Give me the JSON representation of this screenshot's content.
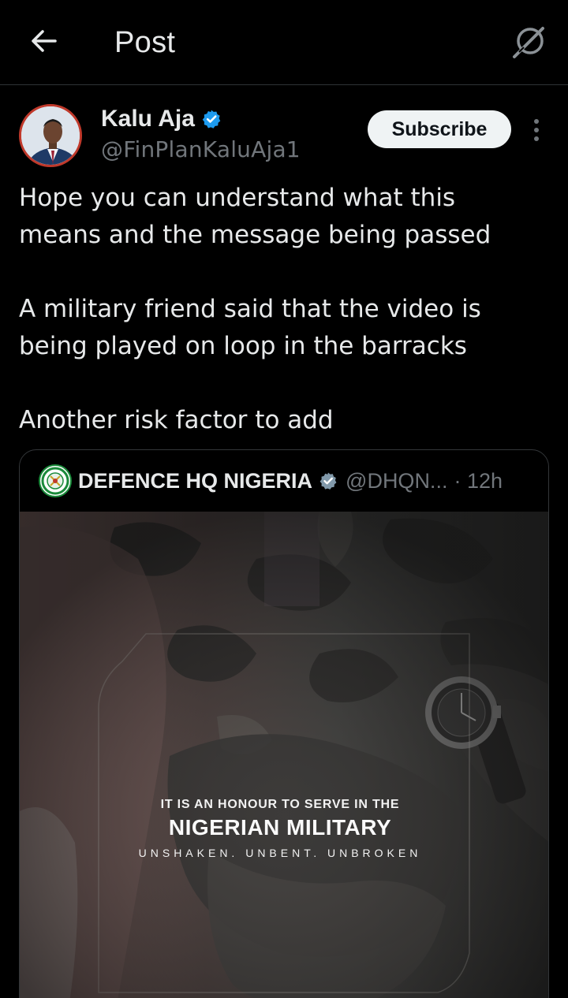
{
  "header": {
    "title": "Post",
    "back_icon": "arrow-left-icon",
    "grok_icon": "grok-icon"
  },
  "author": {
    "name": "Kalu Aja",
    "handle": "@FinPlanKaluAja1",
    "verified_color": "#1d9bf0",
    "subscribe_label": "Subscribe"
  },
  "tweet": {
    "text": "Hope you can understand what this\nmeans and the message being passed\n\nA military friend said that the video is\nbeing played on loop in the barracks\n\nAnother risk factor to add"
  },
  "quote": {
    "name": "DEFENCE HQ NIGERIA",
    "handle": "@DHQN...",
    "time": "· 12h",
    "verified_color": "#829aab",
    "poster": {
      "line1": "IT IS AN HONOUR TO SERVE IN THE",
      "line2": "NIGERIAN MILITARY",
      "line3": "UNSHAKEN. UNBENT. UNBROKEN"
    }
  },
  "colors": {
    "background": "#000000",
    "text": "#e7e9ea",
    "secondary": "#71767b",
    "border": "#2f3336"
  }
}
